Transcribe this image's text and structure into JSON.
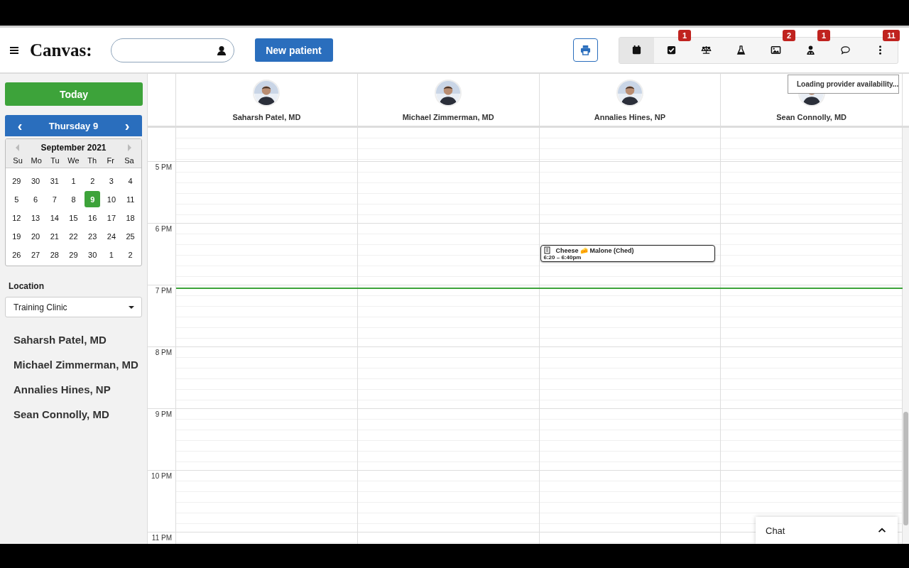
{
  "header": {
    "logo": "Canvas:",
    "new_patient": "New patient",
    "toolbar": [
      {
        "selected": true
      },
      {
        "selected": false,
        "badge": "1"
      },
      {
        "selected": false
      },
      {
        "selected": false
      },
      {
        "selected": false,
        "badge": "2"
      },
      {
        "selected": false,
        "badge": "1"
      },
      {
        "selected": false
      },
      {
        "selected": false,
        "badge": "11"
      }
    ]
  },
  "sidebar": {
    "today": "Today",
    "date_nav": {
      "label": "Thursday 9",
      "prev": "‹",
      "next": "›"
    },
    "mini_calendar": {
      "title": "September 2021",
      "weekdays": [
        "Su",
        "Mo",
        "Tu",
        "We",
        "Th",
        "Fr",
        "Sa"
      ],
      "weeks": [
        [
          {
            "d": "29",
            "selected": false
          },
          {
            "d": "30",
            "selected": false
          },
          {
            "d": "31",
            "selected": false
          },
          {
            "d": "1",
            "selected": false
          },
          {
            "d": "2",
            "selected": false
          },
          {
            "d": "3",
            "selected": false
          },
          {
            "d": "4",
            "selected": false
          }
        ],
        [
          {
            "d": "5",
            "selected": false
          },
          {
            "d": "6",
            "selected": false
          },
          {
            "d": "7",
            "selected": false
          },
          {
            "d": "8",
            "selected": false
          },
          {
            "d": "9",
            "selected": true
          },
          {
            "d": "10",
            "selected": false
          },
          {
            "d": "11",
            "selected": false
          }
        ],
        [
          {
            "d": "12",
            "selected": false
          },
          {
            "d": "13",
            "selected": false
          },
          {
            "d": "14",
            "selected": false
          },
          {
            "d": "15",
            "selected": false
          },
          {
            "d": "16",
            "selected": false
          },
          {
            "d": "17",
            "selected": false
          },
          {
            "d": "18",
            "selected": false
          }
        ],
        [
          {
            "d": "19",
            "selected": false
          },
          {
            "d": "20",
            "selected": false
          },
          {
            "d": "21",
            "selected": false
          },
          {
            "d": "22",
            "selected": false
          },
          {
            "d": "23",
            "selected": false
          },
          {
            "d": "24",
            "selected": false
          },
          {
            "d": "25",
            "selected": false
          }
        ],
        [
          {
            "d": "26",
            "selected": false
          },
          {
            "d": "27",
            "selected": false
          },
          {
            "d": "28",
            "selected": false
          },
          {
            "d": "29",
            "selected": false
          },
          {
            "d": "30",
            "selected": false
          },
          {
            "d": "1",
            "selected": false
          },
          {
            "d": "2",
            "selected": false
          }
        ]
      ]
    },
    "location_label": "Location",
    "location": "Training Clinic",
    "providers": [
      "Saharsh Patel, MD",
      "Michael Zimmerman, MD",
      "Annalies Hines, NP",
      "Sean Connolly, MD"
    ]
  },
  "schedule": {
    "providers": [
      {
        "name": "Saharsh Patel, MD"
      },
      {
        "name": "Michael Zimmerman, MD"
      },
      {
        "name": "Annalies Hines, NP",
        "events": [
          {
            "title": "Cheese 🧀 Malone (Ched)",
            "time": "6:20 – 6:40pm"
          }
        ]
      },
      {
        "name": "Sean Connolly, MD"
      }
    ],
    "hours": [
      "5 PM",
      "6 PM",
      "7 PM",
      "8 PM",
      "9 PM",
      "10 PM",
      "11 PM"
    ],
    "loading": "Loading provider availability..."
  },
  "chat": {
    "label": "Chat"
  }
}
